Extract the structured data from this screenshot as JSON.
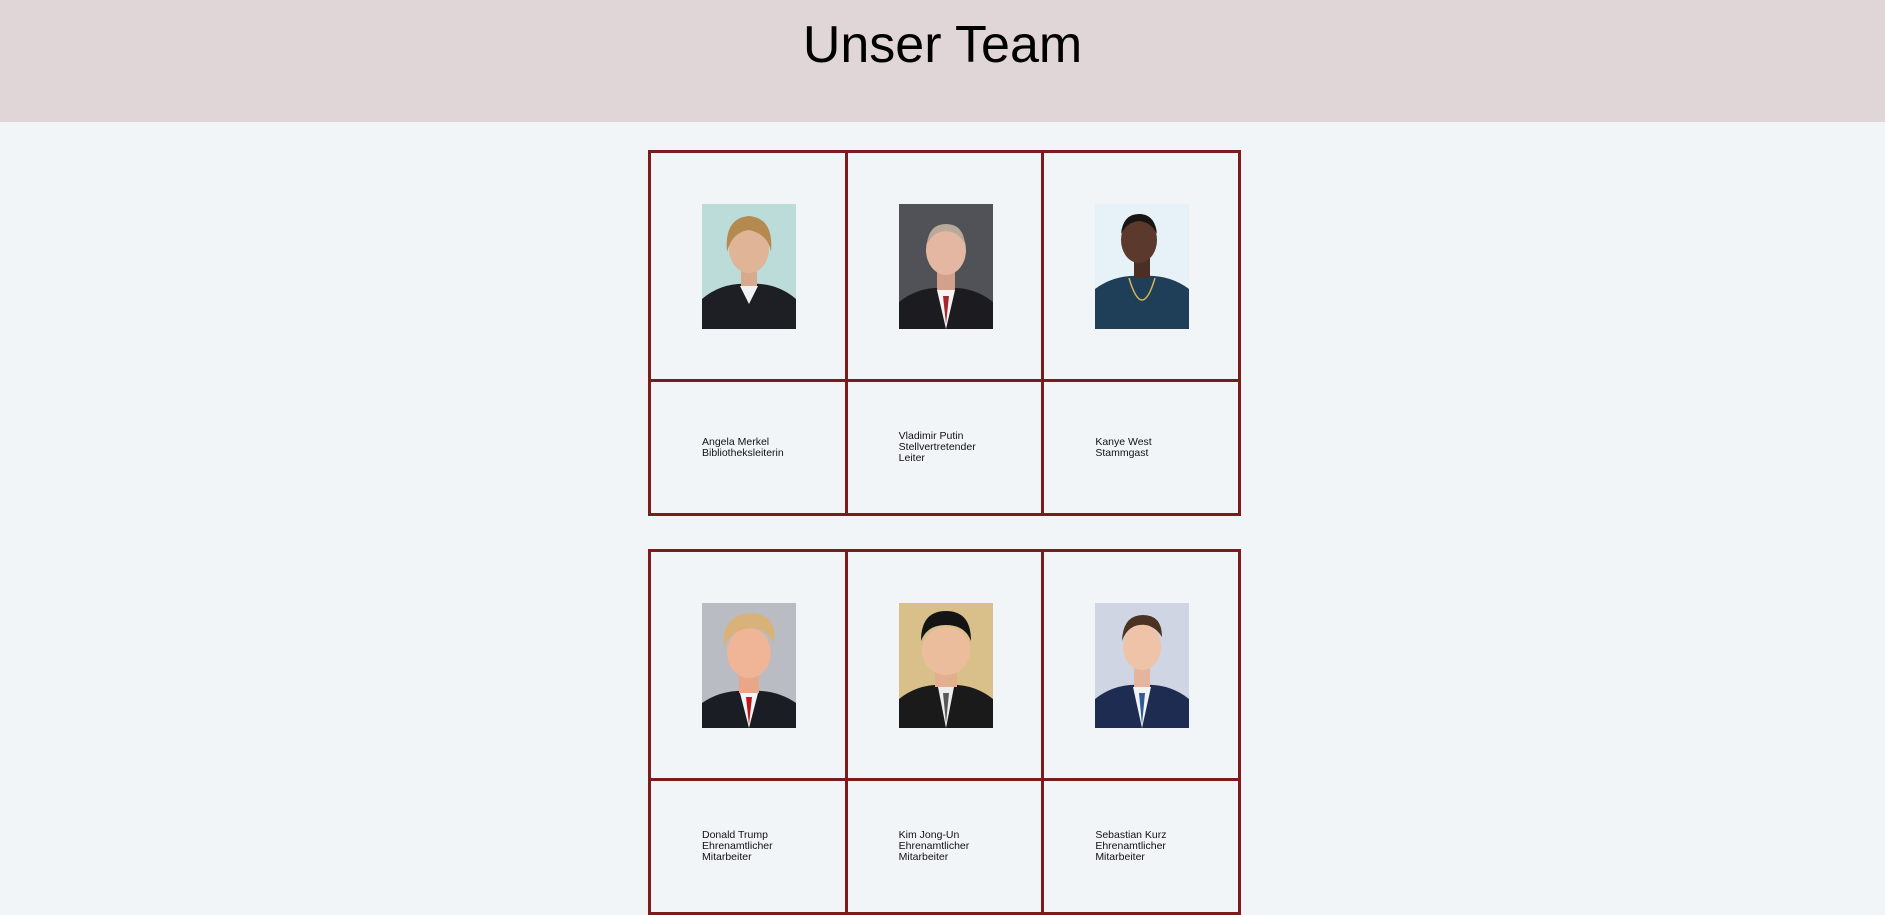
{
  "header": {
    "title": "Unser Team"
  },
  "teams": [
    {
      "members": [
        {
          "name": "Angela Merkel",
          "role": "Bibliotheksleiterin"
        },
        {
          "name": "Vladimir Putin",
          "role": "Stellvertretender Leiter"
        },
        {
          "name": "Kanye West",
          "role": "Stammgast"
        }
      ]
    },
    {
      "members": [
        {
          "name": "Donald Trump",
          "role": "Ehrenamtlicher Mitarbeiter"
        },
        {
          "name": "Kim Jong-Un",
          "role": "Ehrenamtlicher Mitarbeiter"
        },
        {
          "name": "Sebastian Kurz",
          "role": "Ehrenamtlicher Mitarbeiter"
        }
      ]
    }
  ],
  "colors": {
    "header_bg": "#e0d6d7",
    "page_bg": "#f2f5f8",
    "table_border": "#7a1c1c"
  }
}
